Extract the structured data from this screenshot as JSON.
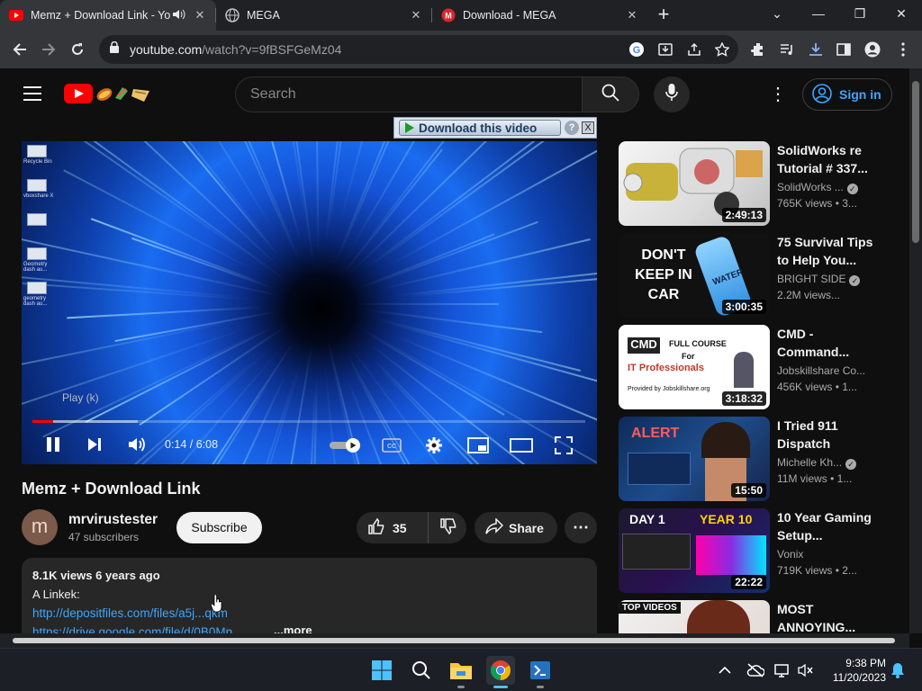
{
  "browser": {
    "tabs": [
      {
        "title": "Memz + Download Link - Yo",
        "active": true,
        "favicon": "youtube-icon"
      },
      {
        "title": "MEGA",
        "active": false,
        "favicon": "globe-icon"
      },
      {
        "title": "Download - MEGA",
        "active": false,
        "favicon": "mega-icon"
      }
    ],
    "url_host": "youtube.com",
    "url_path": "/watch?v=9fBSFGeMz04"
  },
  "youtube": {
    "search_placeholder": "Search",
    "sign_in": "Sign in",
    "download_bar": {
      "button": "Download this video",
      "help": "?",
      "close": "X"
    },
    "player": {
      "hint": "Play (k)",
      "time": "0:14 / 6:08",
      "progress": 0.038,
      "buffered": 0.19,
      "desktop_icons": [
        "Recycle Bin",
        "vboxshare X",
        "",
        "Geometry dash au...",
        "geometry dash au..."
      ]
    },
    "video_title": "Memz + Download Link",
    "channel": {
      "avatar_letter": "m",
      "name": "mrvirustester",
      "subscribers": "47 subscribers"
    },
    "subscribe": "Subscribe",
    "likes": "35",
    "share": "Share",
    "description": {
      "meta": "8.1K views  6 years ago",
      "line1": "A Linkek:",
      "link1": "http://depositfiles.com/files/a5j...qkm",
      "link2": "https://drive.google.com/file/d/0B0Mp...",
      "more": "...more"
    },
    "sidebar": [
      {
        "title": "SolidWorks re Tutorial # 337...",
        "channel": "SolidWorks ...",
        "verified": true,
        "views": "765K views  • 3...",
        "duration": "2:49:13"
      },
      {
        "title": "75 Survival Tips to Help You...",
        "channel": "BRIGHT SIDE",
        "verified": true,
        "views": "2.2M views...",
        "duration": "3:00:35",
        "thumb_text": [
          "DON'T",
          "KEEP IN",
          "CAR"
        ],
        "thumb_badge": "WATER"
      },
      {
        "title": "CMD - Command...",
        "channel": "Jobskillshare Co...",
        "verified": false,
        "views": "456K views  • 1...",
        "duration": "3:18:32",
        "thumb_text": [
          "CMD",
          "FULL COURSE",
          "For",
          "IT Professionals",
          "Provided by Jobskillshare.org"
        ]
      },
      {
        "title": "I Tried 911 Dispatch",
        "channel": "Michelle Kh...",
        "verified": true,
        "views": "11M views  • 1...",
        "duration": "15:50",
        "thumb_text": [
          "ALERT"
        ]
      },
      {
        "title": "10 Year Gaming Setup...",
        "channel": "Vonix",
        "verified": false,
        "views": "719K views  • 2...",
        "duration": "22:22",
        "thumb_text": [
          "DAY 1",
          "YEAR 10"
        ]
      },
      {
        "title": "MOST ANNOYING...",
        "channel": "",
        "verified": false,
        "views": "",
        "duration": "",
        "thumb_text": [
          "TOP VIDEOS"
        ]
      }
    ]
  },
  "taskbar": {
    "time": "9:38 PM",
    "date": "11/20/2023"
  },
  "colors": {
    "brand_red": "#ff0000",
    "link_blue": "#3ea6ff",
    "bg": "#0f0f0f"
  }
}
